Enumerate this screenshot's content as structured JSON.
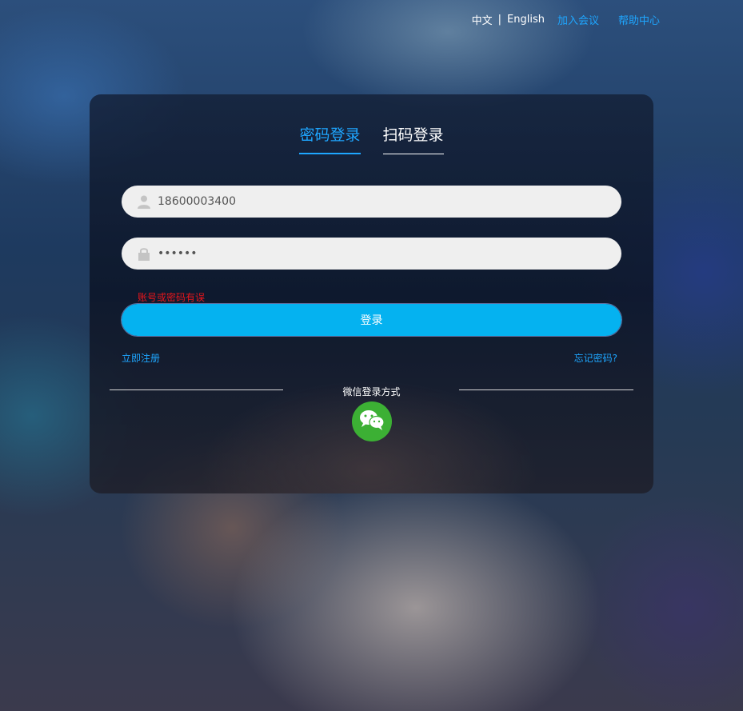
{
  "topnav": {
    "lang_zh": "中文",
    "separator": "|",
    "lang_en": "English",
    "join_meeting": "加入会议",
    "help_center": "帮助中心"
  },
  "tabs": {
    "password_login": "密码登录",
    "scan_login": "扫码登录",
    "active": "password_login"
  },
  "form": {
    "account_value": "18600003400",
    "password_value": "••••••",
    "error_message": "账号或密码有误",
    "login_button": "登录",
    "register_link": "立即注册",
    "forgot_link": "忘记密码?"
  },
  "wechat": {
    "label": "微信登录方式",
    "icon": "wechat-icon"
  },
  "colors": {
    "accent": "#1ea6ff",
    "button": "#05b2f0",
    "error": "#e8161b",
    "wechat": "#3cb034",
    "input_bg": "#efefef"
  }
}
